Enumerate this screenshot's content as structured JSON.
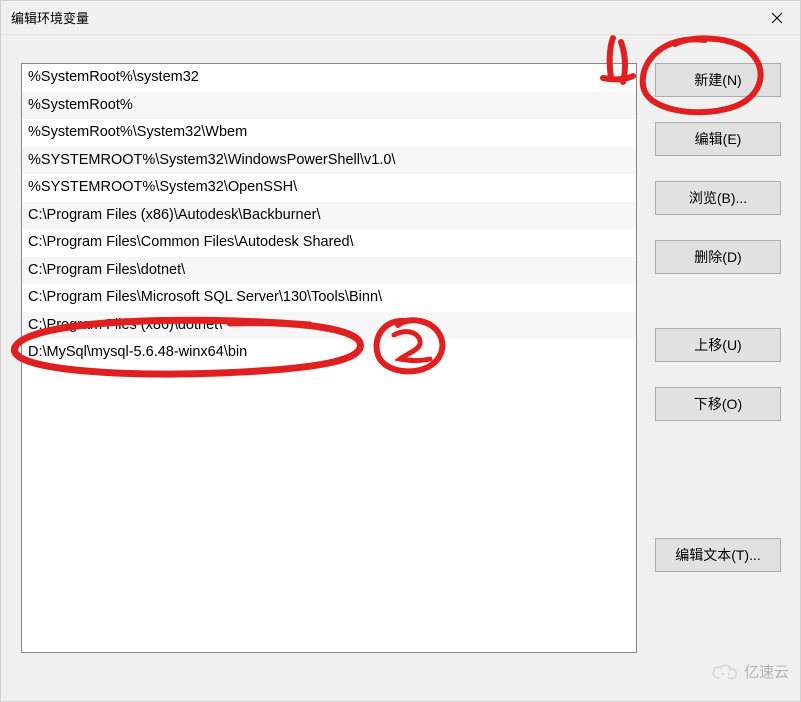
{
  "window": {
    "title": "编辑环境变量"
  },
  "list": {
    "items": [
      "%SystemRoot%\\system32",
      "%SystemRoot%",
      "%SystemRoot%\\System32\\Wbem",
      "%SYSTEMROOT%\\System32\\WindowsPowerShell\\v1.0\\",
      "%SYSTEMROOT%\\System32\\OpenSSH\\",
      "C:\\Program Files (x86)\\Autodesk\\Backburner\\",
      "C:\\Program Files\\Common Files\\Autodesk Shared\\",
      "C:\\Program Files\\dotnet\\",
      "C:\\Program Files\\Microsoft SQL Server\\130\\Tools\\Binn\\",
      "C:\\Program Files (x86)\\dotnet\\",
      "D:\\MySql\\mysql-5.6.48-winx64\\bin"
    ]
  },
  "buttons": {
    "new": "新建(N)",
    "edit": "编辑(E)",
    "browse": "浏览(B)...",
    "delete": "删除(D)",
    "moveUp": "上移(U)",
    "moveDown": "下移(O)",
    "editText": "编辑文本(T)..."
  },
  "annotations": {
    "mark1": "1",
    "mark2": "2"
  },
  "watermark": {
    "text": "亿速云"
  }
}
